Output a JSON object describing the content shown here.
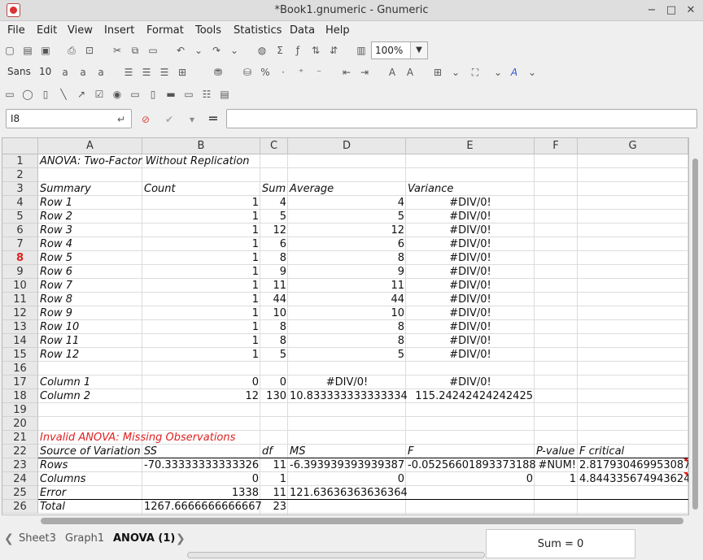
{
  "window": {
    "title": "*Book1.gnumeric - Gnumeric",
    "minimize": "−",
    "maximize": "□",
    "close": "✕"
  },
  "menu": [
    "File",
    "Edit",
    "View",
    "Insert",
    "Format",
    "Tools",
    "Statistics",
    "Data",
    "Help"
  ],
  "toolbar": {
    "zoom": "100%",
    "font_name": "Sans",
    "font_size": "10"
  },
  "formula_bar": {
    "cell_ref": "I8",
    "equals": "=",
    "formula": ""
  },
  "columns": [
    "A",
    "B",
    "C",
    "D",
    "E",
    "F",
    "G"
  ],
  "rows": [
    "1",
    "2",
    "3",
    "4",
    "5",
    "6",
    "7",
    "8",
    "9",
    "10",
    "11",
    "12",
    "13",
    "14",
    "15",
    "16",
    "17",
    "18",
    "19",
    "20",
    "21",
    "22",
    "23",
    "24",
    "25",
    "26"
  ],
  "active_row": "8",
  "cells": {
    "r1": {
      "A": "ANOVA: Two-Factor Without Replication"
    },
    "r3": {
      "A": "Summary",
      "B": "Count",
      "C": "Sum",
      "D": "Average",
      "E": "Variance"
    },
    "r4": {
      "A": "Row 1",
      "B": "1",
      "C": "4",
      "D": "4",
      "E": "#DIV/0!"
    },
    "r5": {
      "A": "Row 2",
      "B": "1",
      "C": "5",
      "D": "5",
      "E": "#DIV/0!"
    },
    "r6": {
      "A": "Row 3",
      "B": "1",
      "C": "12",
      "D": "12",
      "E": "#DIV/0!"
    },
    "r7": {
      "A": "Row 4",
      "B": "1",
      "C": "6",
      "D": "6",
      "E": "#DIV/0!"
    },
    "r8": {
      "A": "Row 5",
      "B": "1",
      "C": "8",
      "D": "8",
      "E": "#DIV/0!"
    },
    "r9": {
      "A": "Row 6",
      "B": "1",
      "C": "9",
      "D": "9",
      "E": "#DIV/0!"
    },
    "r10": {
      "A": "Row 7",
      "B": "1",
      "C": "11",
      "D": "11",
      "E": "#DIV/0!"
    },
    "r11": {
      "A": "Row 8",
      "B": "1",
      "C": "44",
      "D": "44",
      "E": "#DIV/0!"
    },
    "r12": {
      "A": "Row 9",
      "B": "1",
      "C": "10",
      "D": "10",
      "E": "#DIV/0!"
    },
    "r13": {
      "A": "Row 10",
      "B": "1",
      "C": "8",
      "D": "8",
      "E": "#DIV/0!"
    },
    "r14": {
      "A": "Row 11",
      "B": "1",
      "C": "8",
      "D": "8",
      "E": "#DIV/0!"
    },
    "r15": {
      "A": "Row 12",
      "B": "1",
      "C": "5",
      "D": "5",
      "E": "#DIV/0!"
    },
    "r17": {
      "A": "Column 1",
      "B": "0",
      "C": "0",
      "D": "#DIV/0!",
      "E": "#DIV/0!"
    },
    "r18": {
      "A": "Column 2",
      "B": "12",
      "C": "130",
      "D": "10.833333333333334",
      "E": "115.24242424242425"
    },
    "r21": {
      "A": "Invalid ANOVA: Missing Observations"
    },
    "r22": {
      "A": "Source of Variation",
      "B": "SS",
      "C": "df",
      "D": "MS",
      "E": "F",
      "F": "P-value",
      "G": "F critical"
    },
    "r23": {
      "A": "Rows",
      "B": "-70.33333333333326",
      "C": "11",
      "D": "-6.393939393939387",
      "E": "-0.05256601893373188",
      "F": "#NUM!",
      "G": "2.817930469953087"
    },
    "r24": {
      "A": "Columns",
      "B": "0",
      "C": "1",
      "D": "0",
      "E": "0",
      "F": "1",
      "G": "4.844335674943624"
    },
    "r25": {
      "A": "Error",
      "B": "1338",
      "C": "11",
      "D": "121.63636363636364"
    },
    "r26": {
      "A": "Total",
      "B": "1267.6666666666667",
      "C": "23"
    }
  },
  "sheets": [
    "Sheet3",
    "Graph1",
    "ANOVA (1)"
  ],
  "active_sheet": "ANOVA (1)",
  "status": {
    "sum": "Sum = 0"
  },
  "colors": {
    "accent_red": "#e02020"
  }
}
